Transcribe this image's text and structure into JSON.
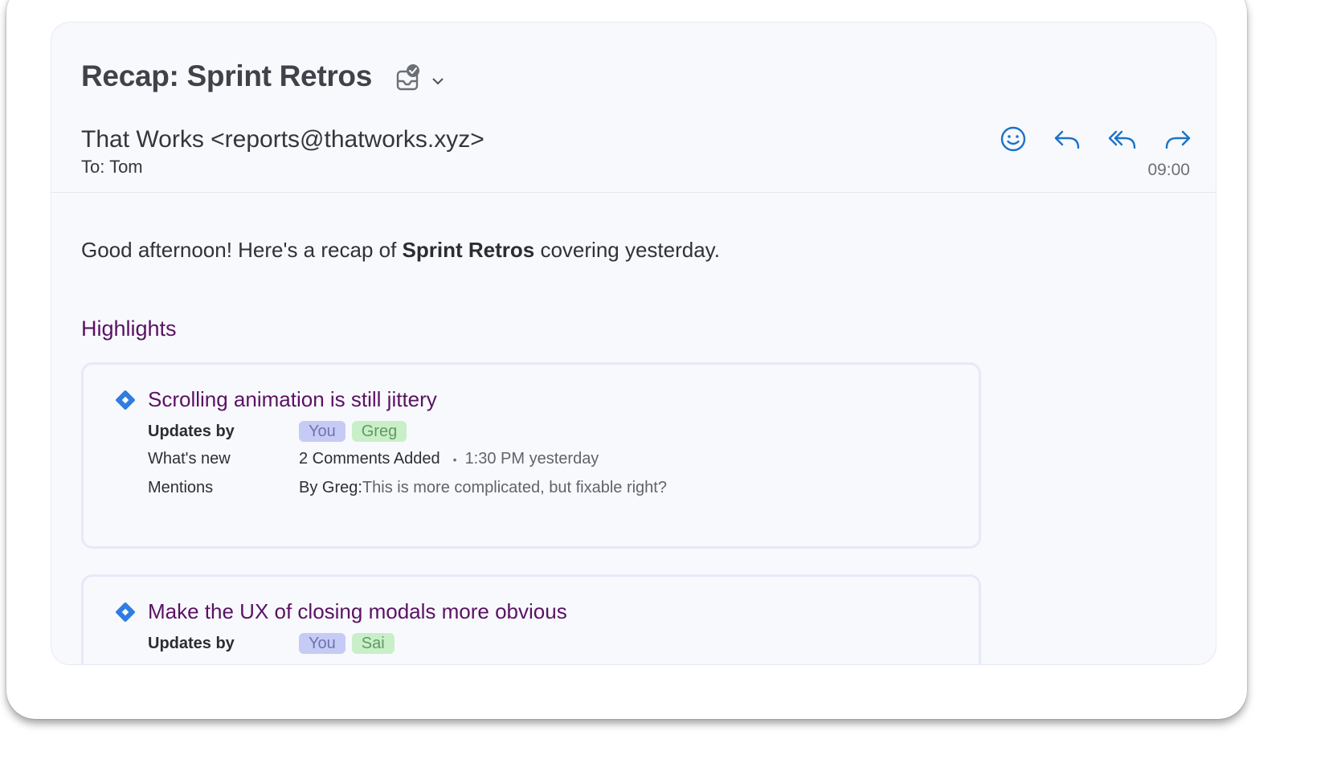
{
  "email": {
    "subject": "Recap: Sprint Retros",
    "sender": "That Works <reports@thatworks.xyz>",
    "recipient": "To: Tom",
    "time": "09:00"
  },
  "actions": {
    "icons": [
      "smiley-icon",
      "reply-icon",
      "reply-all-icon",
      "forward-icon"
    ]
  },
  "body": {
    "greeting_prefix": "Good afternoon! Here's a recap of ",
    "greeting_bold": "Sprint Retros",
    "greeting_suffix": " covering yesterday.",
    "section_title": "Highlights"
  },
  "items": [
    {
      "title": "Scrolling animation is still jittery",
      "updates_label": "Updates by",
      "chips": [
        "You",
        "Greg"
      ],
      "whats_new_label": "What's new",
      "whats_new_value": "2 Comments Added",
      "whats_new_time": "1:30 PM yesterday",
      "mentions_label": "Mentions",
      "mentions_by": "By Greg:",
      "mentions_text": "This is more complicated, but fixable right?"
    },
    {
      "title": "Make the UX of closing modals more obvious",
      "updates_label": "Updates by",
      "chips": [
        "You",
        "Sai"
      ]
    }
  ],
  "colors": {
    "accent": "#5a1263",
    "icon_blue": "#1a73c8",
    "chip_you_bg": "#c6cbf6",
    "chip_other_bg": "#c9efc9",
    "diamond": "#2f7de1"
  }
}
